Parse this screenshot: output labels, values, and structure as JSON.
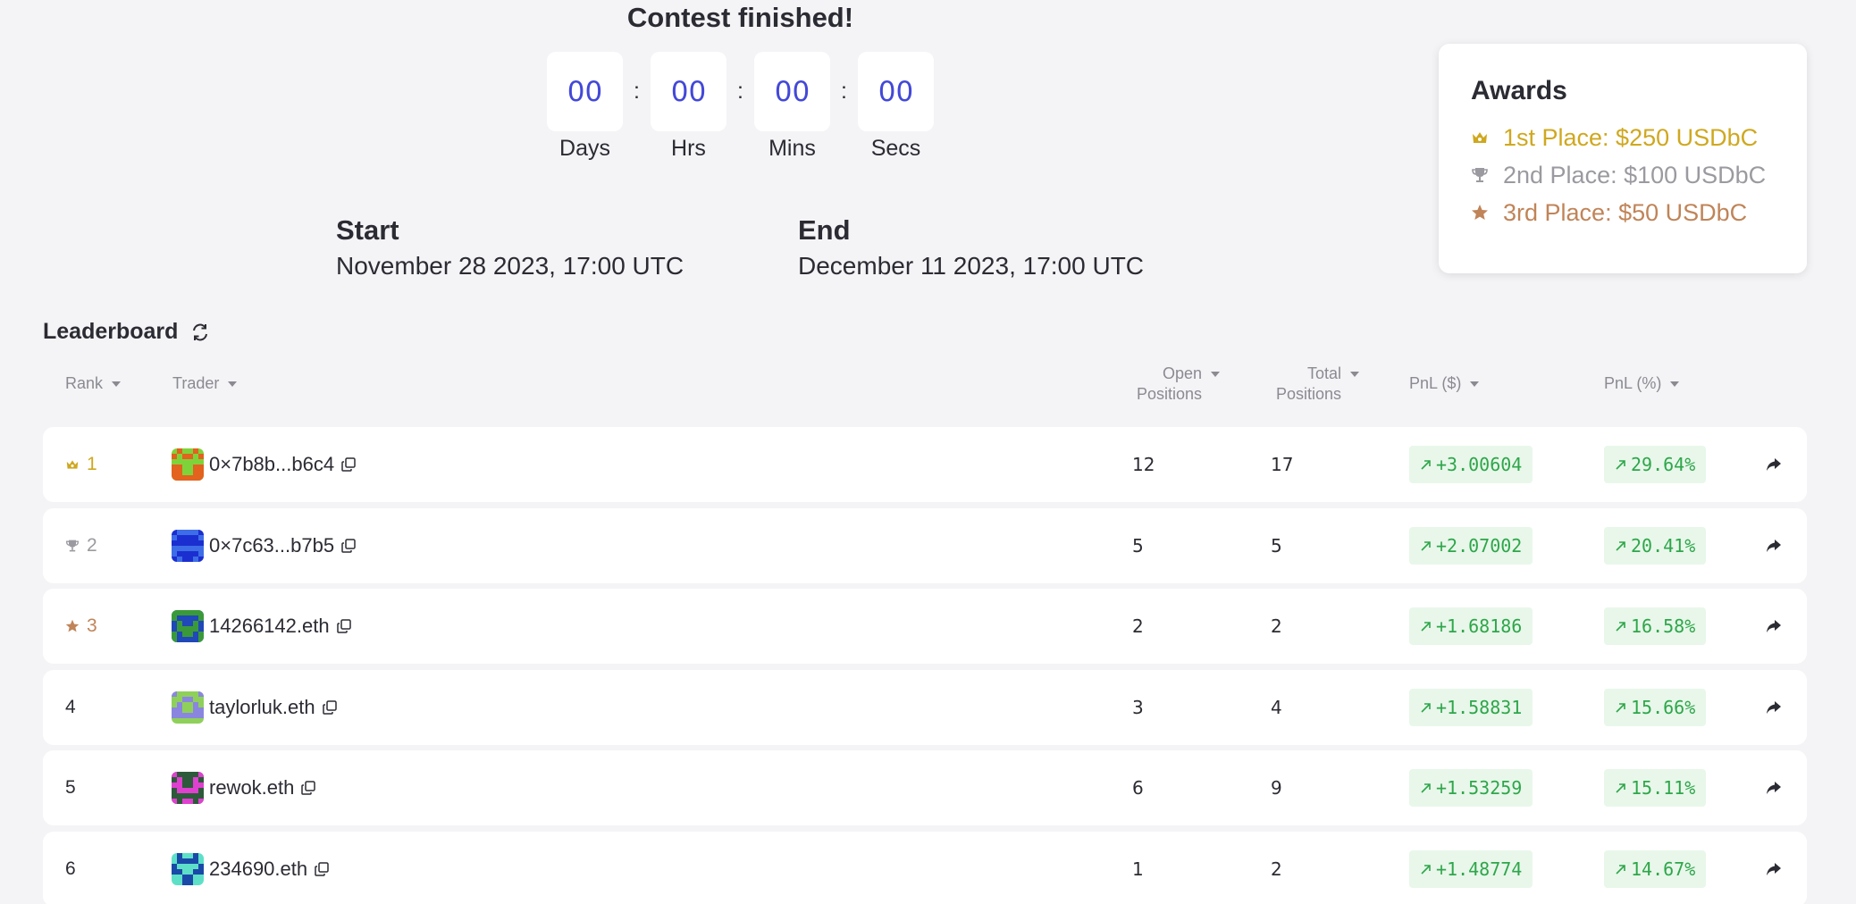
{
  "contest": {
    "status": "Contest finished!"
  },
  "countdown": [
    {
      "value": "00",
      "label": "Days"
    },
    {
      "value": "00",
      "label": "Hrs"
    },
    {
      "value": "00",
      "label": "Mins"
    },
    {
      "value": "00",
      "label": "Secs"
    }
  ],
  "countdown_separator": ":",
  "period": {
    "start_label": "Start",
    "start_value": "November 28 2023, 17:00 UTC",
    "end_label": "End",
    "end_value": "December 11 2023, 17:00 UTC"
  },
  "awards": {
    "title": "Awards",
    "items": [
      {
        "icon": "crown-icon",
        "text": "1st Place: $250 USDbC",
        "color": "#cfa81f"
      },
      {
        "icon": "trophy-icon",
        "text": "2nd Place: $100 USDbC",
        "color": "#9a9aa0"
      },
      {
        "icon": "star-icon",
        "text": "3rd Place: $50 USDbC",
        "color": "#c08458"
      }
    ]
  },
  "leaderboard": {
    "title": "Leaderboard",
    "columns": {
      "rank": "Rank",
      "trader": "Trader",
      "open_line1": "Open",
      "open_line2": "Positions",
      "total_line1": "Total",
      "total_line2": "Positions",
      "pnl_usd": "PnL ($)",
      "pnl_pct": "PnL (%)"
    },
    "rows": [
      {
        "rank": "1",
        "rank_icon": "crown-icon",
        "rank_color": "#cfa81f",
        "trader": "0×7b8b...b6c4",
        "open": "12",
        "total": "17",
        "pnl_usd": "+3.00604",
        "pnl_pct": "29.64%",
        "avatar": {
          "bg": "#7fd33a",
          "fg": "#e2621e"
        }
      },
      {
        "rank": "2",
        "rank_icon": "trophy-icon",
        "rank_color": "#9a9aa0",
        "trader": "0×7c63...b7b5",
        "open": "5",
        "total": "5",
        "pnl_usd": "+2.07002",
        "pnl_pct": "20.41%",
        "avatar": {
          "bg": "#1b2fd0",
          "fg": "#3e6de8"
        }
      },
      {
        "rank": "3",
        "rank_icon": "star-icon",
        "rank_color": "#c08458",
        "trader": "14266142.eth",
        "open": "2",
        "total": "2",
        "pnl_usd": "+1.68186",
        "pnl_pct": "16.58%",
        "avatar": {
          "bg": "#2048b8",
          "fg": "#3a9a3a"
        }
      },
      {
        "rank": "4",
        "rank_icon": "",
        "rank_color": "#2b2b33",
        "trader": "taylorluk.eth",
        "open": "3",
        "total": "4",
        "pnl_usd": "+1.58831",
        "pnl_pct": "15.66%",
        "avatar": {
          "bg": "#8fd05a",
          "fg": "#8a86e0"
        }
      },
      {
        "rank": "5",
        "rank_icon": "",
        "rank_color": "#2b2b33",
        "trader": "rewok.eth",
        "open": "6",
        "total": "9",
        "pnl_usd": "+1.53259",
        "pnl_pct": "15.11%",
        "avatar": {
          "bg": "#2d5a3a",
          "fg": "#e040d0"
        }
      },
      {
        "rank": "6",
        "rank_icon": "",
        "rank_color": "#2b2b33",
        "trader": "234690.eth",
        "open": "1",
        "total": "2",
        "pnl_usd": "+1.48774",
        "pnl_pct": "14.67%",
        "avatar": {
          "bg": "#5ee0c8",
          "fg": "#1a4aa8"
        }
      }
    ]
  }
}
